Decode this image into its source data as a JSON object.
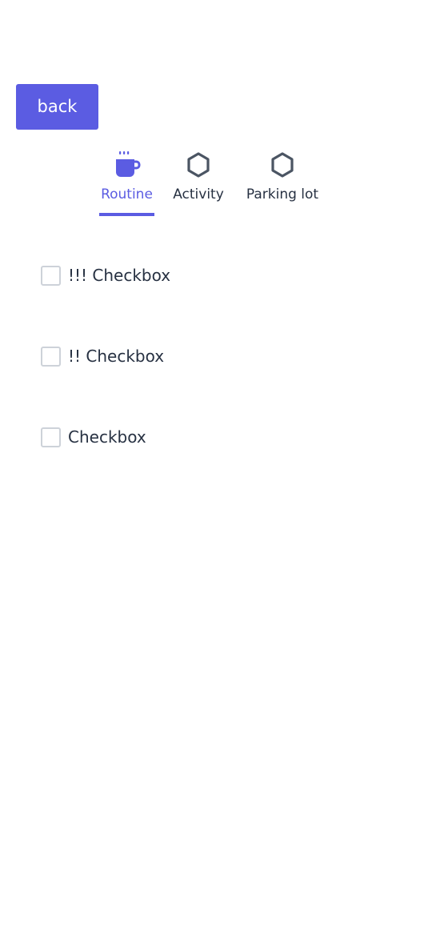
{
  "header": {
    "back_label": "back"
  },
  "tabs": [
    {
      "label": "Routine",
      "icon": "coffee-mug-icon",
      "active": true
    },
    {
      "label": "Activity",
      "icon": "hexagon-icon",
      "active": false
    },
    {
      "label": "Parking lot",
      "icon": "hexagon-icon",
      "active": false
    }
  ],
  "checklist": [
    {
      "label": "!!! Checkbox",
      "checked": false
    },
    {
      "label": "!! Checkbox",
      "checked": false
    },
    {
      "label": "Checkbox",
      "checked": false
    }
  ],
  "colors": {
    "accent": "#5b5ce2",
    "text": "#273142",
    "checkbox_border": "#cdd2d9"
  }
}
